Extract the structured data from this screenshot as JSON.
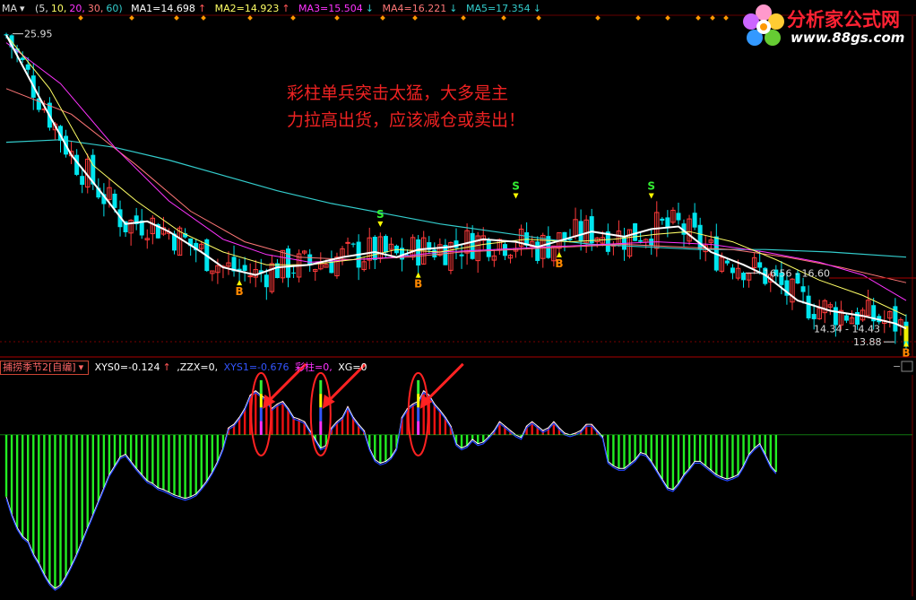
{
  "header": {
    "indicator": "MA",
    "params_prefix": "(5,",
    "params_10": "10,",
    "params_20": "20,",
    "params_30": "30,",
    "params_60": "60)",
    "ma1": "MA1=14.698",
    "ma2": "MA2=14.923",
    "ma3": "MA3=15.504",
    "ma4": "MA4=16.221",
    "ma5": "MA5=17.354",
    "arrow_up": "↑",
    "arrow_down": "↓"
  },
  "logo": {
    "title": "分析家公式网",
    "url": "www.88gs.com"
  },
  "annotation": {
    "line1": "彩柱单兵突击太猛，大多是主",
    "line2": "力拉高出货，应该减仓或卖出！"
  },
  "price_labels": {
    "top": "25.95",
    "range1": "16.56 - 16.60",
    "range2": "14.34 - 14.43",
    "low": "13.88"
  },
  "signals": {
    "sell": "S",
    "buy": "B"
  },
  "sub_header": {
    "indicator_name": "捕捞季节2[自编]",
    "xys0": "XYS0=-0.124",
    "zzx": ",ZZX=0,",
    "xys1": "XYS1=-0.676",
    "caizhu": "彩柱=0,",
    "xg": "XG=0"
  },
  "colors": {
    "up": "#ff3b3b",
    "down": "#00e5ee",
    "ma5": "#ffffff",
    "ma10": "#ffff66",
    "ma20": "#ff33ff",
    "ma30": "#ff7777",
    "ma60": "#33cccc",
    "hist_pos": "#ee1111",
    "hist_neg": "#22ee22",
    "annotation": "#ee2222"
  },
  "chart_data": [
    {
      "type": "candlestick",
      "title": "MA",
      "ylim": [
        13.5,
        26.5
      ],
      "ma_series": [
        {
          "name": "MA1",
          "period": 5,
          "color": "#ffffff",
          "last": 14.698
        },
        {
          "name": "MA2",
          "period": 10,
          "color": "#ffff66",
          "last": 14.923
        },
        {
          "name": "MA3",
          "period": 20,
          "color": "#ff33ff",
          "last": 15.504
        },
        {
          "name": "MA4",
          "period": 30,
          "color": "#ff7777",
          "last": 16.221
        },
        {
          "name": "MA5",
          "period": 60,
          "color": "#33cccc",
          "last": 17.354
        }
      ],
      "ma_paths": {
        "ma5": [
          [
            0,
            25.9
          ],
          [
            6,
            23.5
          ],
          [
            12,
            21.2
          ],
          [
            18,
            19.6
          ],
          [
            22,
            18.5
          ],
          [
            26,
            18.6
          ],
          [
            30,
            18.2
          ],
          [
            36,
            17.4
          ],
          [
            40,
            16.8
          ],
          [
            46,
            16.5
          ],
          [
            50,
            16.8
          ],
          [
            56,
            16.9
          ],
          [
            62,
            17.2
          ],
          [
            68,
            17.4
          ],
          [
            72,
            17.2
          ],
          [
            76,
            17.5
          ],
          [
            82,
            17.6
          ],
          [
            88,
            17.9
          ],
          [
            94,
            17.8
          ],
          [
            98,
            17.6
          ],
          [
            103,
            17.9
          ],
          [
            108,
            18.2
          ],
          [
            114,
            18.0
          ],
          [
            119,
            18.3
          ],
          [
            124,
            18.4
          ],
          [
            130,
            17.4
          ],
          [
            136,
            16.9
          ],
          [
            140,
            16.5
          ],
          [
            146,
            15.5
          ],
          [
            152,
            15.1
          ],
          [
            158,
            14.9
          ],
          [
            164,
            14.6
          ],
          [
            166,
            14.4
          ]
        ],
        "ma10": [
          [
            0,
            25.9
          ],
          [
            8,
            23.8
          ],
          [
            16,
            20.8
          ],
          [
            24,
            19.4
          ],
          [
            32,
            18.2
          ],
          [
            40,
            17.4
          ],
          [
            48,
            16.9
          ],
          [
            56,
            16.9
          ],
          [
            64,
            17.1
          ],
          [
            72,
            17.5
          ],
          [
            80,
            17.4
          ],
          [
            88,
            17.7
          ],
          [
            96,
            17.9
          ],
          [
            104,
            17.8
          ],
          [
            112,
            17.9
          ],
          [
            120,
            18.1
          ],
          [
            126,
            18.2
          ],
          [
            134,
            17.8
          ],
          [
            142,
            17.1
          ],
          [
            150,
            16.3
          ],
          [
            158,
            15.7
          ],
          [
            166,
            14.9
          ]
        ],
        "ma20": [
          [
            0,
            25.6
          ],
          [
            10,
            24.0
          ],
          [
            20,
            21.5
          ],
          [
            30,
            19.4
          ],
          [
            40,
            17.9
          ],
          [
            48,
            17.3
          ],
          [
            56,
            17.0
          ],
          [
            64,
            17.1
          ],
          [
            72,
            17.2
          ],
          [
            80,
            17.4
          ],
          [
            90,
            17.5
          ],
          [
            100,
            17.6
          ],
          [
            110,
            17.7
          ],
          [
            120,
            17.8
          ],
          [
            130,
            17.7
          ],
          [
            140,
            17.4
          ],
          [
            150,
            17.0
          ],
          [
            158,
            16.5
          ],
          [
            166,
            15.5
          ]
        ],
        "ma30": [
          [
            0,
            23.8
          ],
          [
            12,
            22.8
          ],
          [
            24,
            20.8
          ],
          [
            34,
            19.0
          ],
          [
            44,
            17.8
          ],
          [
            54,
            17.2
          ],
          [
            64,
            17.1
          ],
          [
            74,
            17.2
          ],
          [
            84,
            17.4
          ],
          [
            94,
            17.5
          ],
          [
            104,
            17.6
          ],
          [
            114,
            17.7
          ],
          [
            124,
            17.6
          ],
          [
            134,
            17.5
          ],
          [
            144,
            17.2
          ],
          [
            154,
            16.8
          ],
          [
            166,
            16.2
          ]
        ],
        "ma60": [
          [
            0,
            21.7
          ],
          [
            10,
            21.8
          ],
          [
            20,
            21.5
          ],
          [
            30,
            21.0
          ],
          [
            40,
            20.4
          ],
          [
            50,
            19.8
          ],
          [
            60,
            19.3
          ],
          [
            70,
            18.9
          ],
          [
            80,
            18.5
          ],
          [
            90,
            18.2
          ],
          [
            100,
            17.9
          ],
          [
            108,
            17.7
          ],
          [
            118,
            17.6
          ],
          [
            128,
            17.5
          ],
          [
            140,
            17.5
          ],
          [
            152,
            17.4
          ],
          [
            166,
            17.2
          ]
        ]
      },
      "signal_marks": [
        {
          "index": 43,
          "label": "B",
          "price": 16.2
        },
        {
          "index": 69,
          "label": "S",
          "price": 18.6
        },
        {
          "index": 76,
          "label": "B",
          "price": 16.5
        },
        {
          "index": 94,
          "label": "S",
          "price": 19.7
        },
        {
          "index": 102,
          "label": "B",
          "price": 17.3
        },
        {
          "index": 119,
          "label": "S",
          "price": 19.7
        },
        {
          "index": 166,
          "label": "B",
          "price": 13.8
        }
      ]
    },
    {
      "type": "histogram",
      "title": "捕捞季节2[自编]",
      "ylim": [
        -1.8,
        0.7
      ],
      "baseline": 0,
      "values": [
        -0.7,
        -0.9,
        -1.05,
        -1.15,
        -1.2,
        -1.35,
        -1.45,
        -1.58,
        -1.68,
        -1.74,
        -1.7,
        -1.6,
        -1.48,
        -1.35,
        -1.2,
        -1.05,
        -0.9,
        -0.75,
        -0.6,
        -0.45,
        -0.35,
        -0.25,
        -0.22,
        -0.3,
        -0.38,
        -0.45,
        -0.52,
        -0.55,
        -0.6,
        -0.62,
        -0.65,
        -0.68,
        -0.7,
        -0.72,
        -0.7,
        -0.67,
        -0.6,
        -0.52,
        -0.42,
        -0.3,
        -0.15,
        0.08,
        0.12,
        0.2,
        0.3,
        0.45,
        0.5,
        0.45,
        0.4,
        0.3,
        0.35,
        0.38,
        0.3,
        0.2,
        0.18,
        0.15,
        0.05,
        -0.05,
        -0.15,
        -0.12,
        0.08,
        0.15,
        0.2,
        0.32,
        0.2,
        0.12,
        0.05,
        -0.15,
        -0.28,
        -0.32,
        -0.3,
        -0.25,
        -0.15,
        0.2,
        0.3,
        0.35,
        0.38,
        0.5,
        0.45,
        0.35,
        0.28,
        0.2,
        0.1,
        -0.1,
        -0.15,
        -0.12,
        -0.05,
        -0.1,
        -0.08,
        -0.02,
        0.05,
        0.15,
        0.1,
        0.05,
        0.0,
        -0.03,
        0.1,
        0.15,
        0.1,
        0.05,
        0.08,
        0.15,
        0.08,
        0.02,
        0.0,
        0.02,
        0.05,
        0.12,
        0.12,
        0.05,
        -0.02,
        -0.3,
        -0.35,
        -0.38,
        -0.38,
        -0.33,
        -0.28,
        -0.2,
        -0.22,
        -0.3,
        -0.4,
        -0.5,
        -0.6,
        -0.62,
        -0.55,
        -0.45,
        -0.38,
        -0.3,
        -0.3,
        -0.35,
        -0.4,
        -0.45,
        -0.48,
        -0.5,
        -0.48,
        -0.45,
        -0.35,
        -0.22,
        -0.15,
        -0.1,
        -0.22,
        -0.35,
        -0.42
      ],
      "color_bars": [
        {
          "index": 47,
          "value": 0.62
        },
        {
          "index": 58,
          "value": 0.62
        },
        {
          "index": 76,
          "value": 0.62
        }
      ],
      "callouts": [
        {
          "index": 47,
          "label": ""
        },
        {
          "index": 58,
          "label": ""
        },
        {
          "index": 76,
          "label": ""
        }
      ]
    }
  ]
}
